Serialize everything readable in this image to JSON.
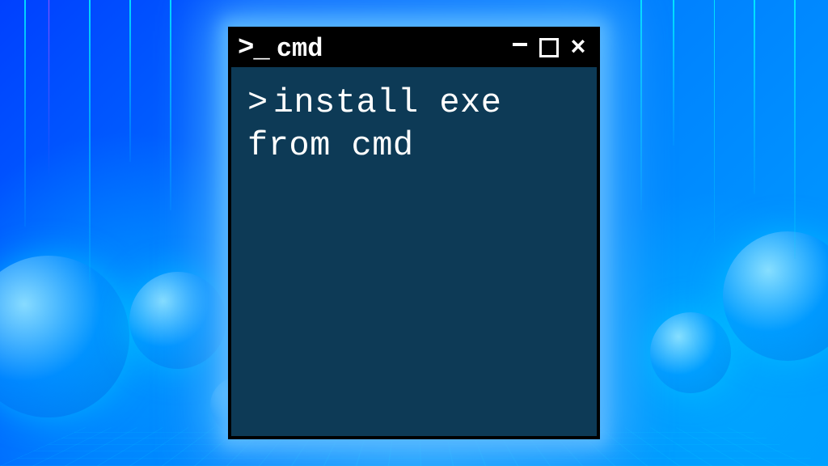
{
  "window": {
    "title": "cmd",
    "icon_name": "terminal-prompt-icon"
  },
  "controls": {
    "minimize": "minimize",
    "maximize": "maximize",
    "close": "×"
  },
  "terminal": {
    "prompt": ">",
    "lines": [
      "install exe from cmd"
    ]
  },
  "colors": {
    "terminal_bg": "#0d3a56",
    "titlebar_bg": "#000000",
    "text": "#ffffff",
    "glow": "#50b4ff"
  }
}
